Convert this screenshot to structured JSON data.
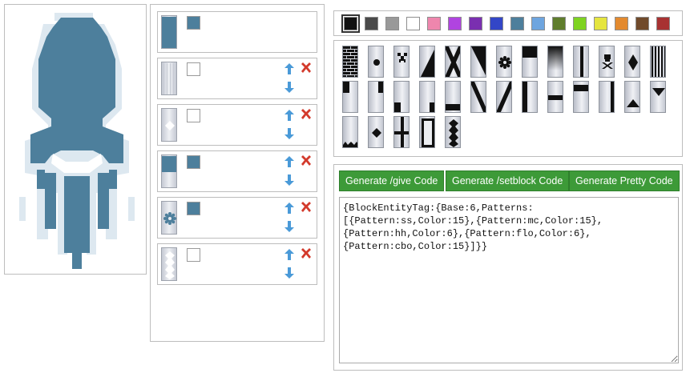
{
  "preview": {
    "icon": "squid-banner-preview",
    "base_color": "#4d7f9c",
    "pattern_color": "#dde8f0"
  },
  "layers": [
    {
      "thumb": "base-solid",
      "swatch": "#4d7f9c",
      "can_reorder": false,
      "can_delete": false
    },
    {
      "thumb": "stripe-small",
      "swatch": "#ffffff",
      "can_reorder": true,
      "can_delete": true
    },
    {
      "thumb": "mojang",
      "swatch": "#ffffff",
      "can_reorder": true,
      "can_delete": true
    },
    {
      "thumb": "half-horizontal",
      "swatch": "#4d7f9c",
      "can_reorder": true,
      "can_delete": true
    },
    {
      "thumb": "flower",
      "swatch": "#4d7f9c",
      "can_reorder": true,
      "can_delete": true
    },
    {
      "thumb": "curly-border",
      "swatch": "#ffffff",
      "can_reorder": true,
      "can_delete": true
    }
  ],
  "colors": [
    "#111111",
    "#4a4a4a",
    "#999999",
    "#ffffff",
    "#ee86ad",
    "#b044e0",
    "#7a2fb0",
    "#3346c7",
    "#4d7f9c",
    "#6ea5df",
    "#5f7d2d",
    "#7ed321",
    "#e5e53f",
    "#e38a2f",
    "#704a2b",
    "#a83232"
  ],
  "selected_color": 0,
  "patterns": [
    "bricks",
    "circle",
    "creeper",
    "diagonal-right",
    "cross",
    "diagonal-left",
    "flower",
    "top-square",
    "gradient",
    "vertical-stripe",
    "skull",
    "rhombus",
    "small-stripes",
    "square-top-left",
    "square-top-right",
    "square-bottom-left",
    "square-bottom-right",
    "bottom-stripe",
    "diagonal-down",
    "diagonal-up",
    "left-stripe",
    "middle-stripe",
    "top-stripe",
    "right-stripe",
    "triangle-bottom",
    "triangle-top",
    "triangles-bottom",
    "mojang",
    "straight-cross",
    "border",
    "curly-border"
  ],
  "buttons": {
    "give": "Generate /give Code",
    "setblock": "Generate /setblock Code",
    "pretty": "Generate Pretty Code"
  },
  "code": "{BlockEntityTag:{Base:6,Patterns:\n[{Pattern:ss,Color:15},{Pattern:mc,Color:15},\n{Pattern:hh,Color:6},{Pattern:flo,Color:6},\n{Pattern:cbo,Color:15}]}}"
}
